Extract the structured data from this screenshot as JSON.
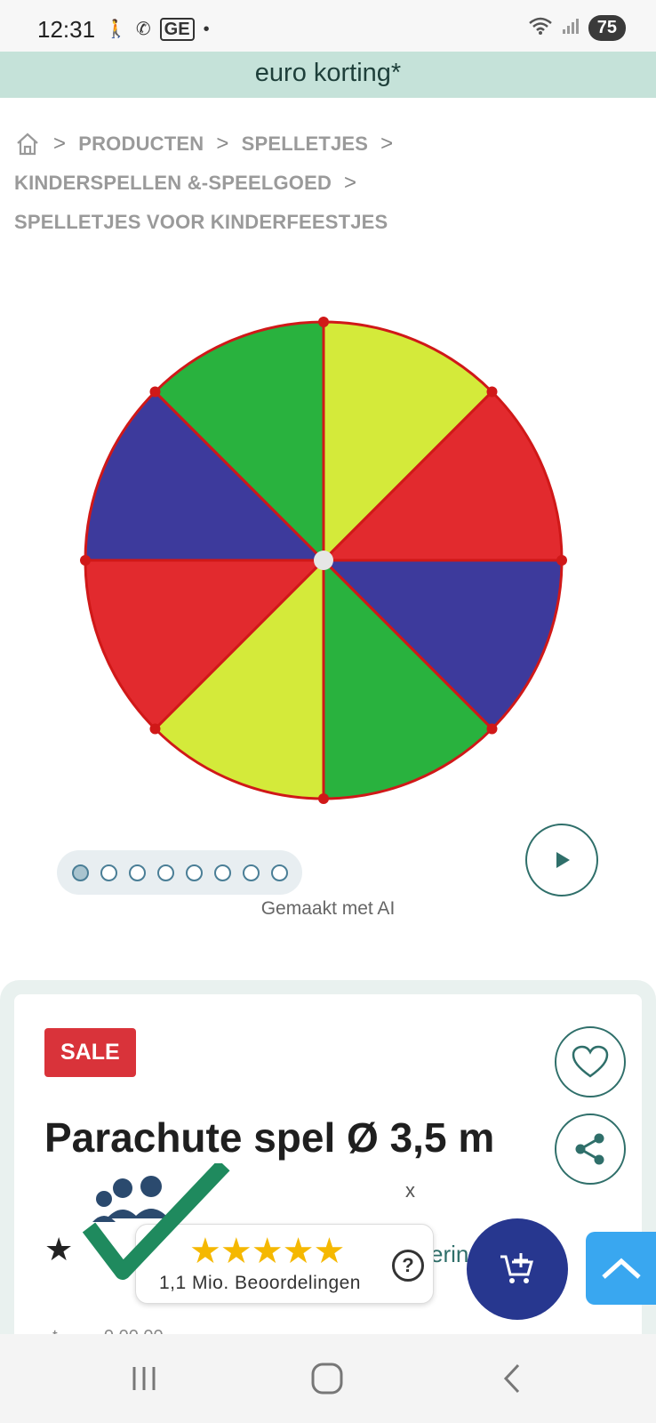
{
  "status_bar": {
    "time": "12:31",
    "icons": [
      "walk-icon",
      "whatsapp-icon",
      "gd-icon",
      "dot-icon"
    ],
    "gd_label": "GE",
    "battery": "75"
  },
  "promo": {
    "text": "euro korting*"
  },
  "breadcrumb": {
    "items": [
      "PRODUCTEN",
      "SPELLETJES",
      "KINDERSPELLEN &-SPEELGOED",
      "SPELLETJES VOOR KINDERFEESTJES"
    ]
  },
  "gallery": {
    "dots_total": 8,
    "active_index": 0,
    "caption": "Gemaakt met AI"
  },
  "product": {
    "badge": "SALE",
    "title": "Parachute spel Ø 3,5 m",
    "rating_star": "★",
    "partial_link": "erin",
    "partial_text": "..t... ..‥ 0.00.00"
  },
  "trust_widget": {
    "stars": "★★★★★",
    "count": "1,1 Mio. Beoordelingen",
    "help": "?",
    "close": "x"
  },
  "colors": {
    "promo_bg": "#c5e2d9",
    "sale_red": "#d9333a",
    "accent_teal": "#2f6f6a",
    "cart_blue": "#27378f",
    "top_blue": "#39a7f0",
    "star_gold": "#f5b800"
  }
}
